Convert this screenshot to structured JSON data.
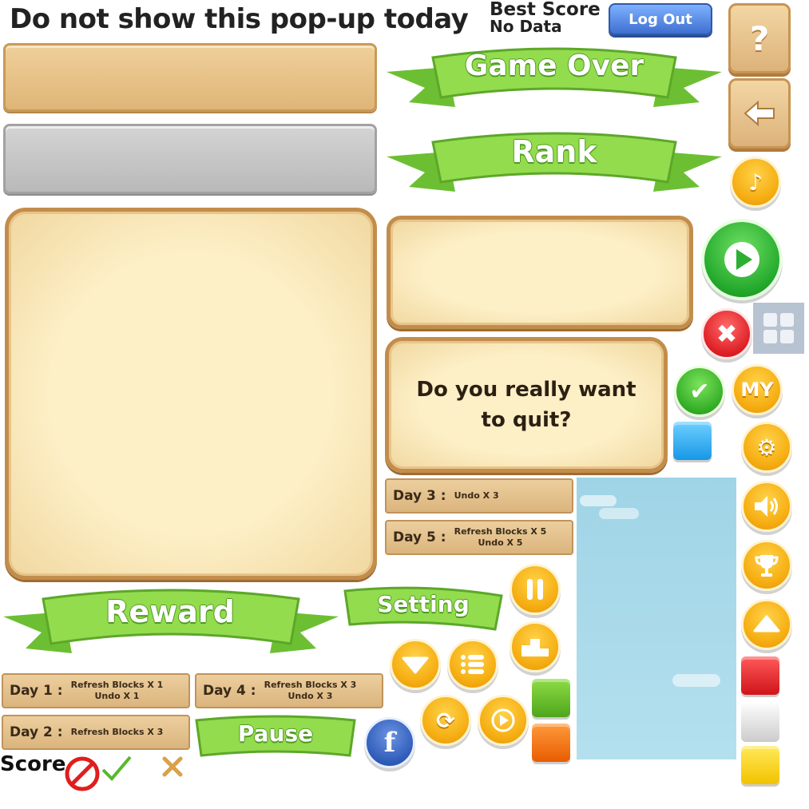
{
  "popup_notice": "Do not show this pop-up today",
  "best_score": {
    "label": "Best Score",
    "value": "No Data"
  },
  "logout_label": "Log Out",
  "banners": {
    "game_over": "Game Over",
    "rank": "Rank",
    "reward": "Reward",
    "setting": "Setting",
    "pause": "Pause"
  },
  "quit_dialog": {
    "message_line1": "Do you really want",
    "message_line2": "to quit?"
  },
  "rewards": [
    {
      "day": "Day 3 :",
      "line1": "Undo X 3",
      "line2": ""
    },
    {
      "day": "Day 5 :",
      "line1": "Refresh Blocks X 5",
      "line2": "Undo X 5"
    },
    {
      "day": "Day 1 :",
      "line1": "Refresh Blocks X 1",
      "line2": "Undo X 1"
    },
    {
      "day": "Day 4 :",
      "line1": "Refresh Blocks X 3",
      "line2": "Undo X 3"
    },
    {
      "day": "Day 2 :",
      "line1": "Refresh Blocks X 3",
      "line2": ""
    }
  ],
  "score_label": "Score",
  "my_label": "MY",
  "icons": {
    "help": "question-icon",
    "back": "arrow-left-icon",
    "music": "music-note-icon",
    "play": "play-icon",
    "close": "close-icon",
    "grid": "grid-icon",
    "confirm": "check-icon",
    "settings": "gear-icon",
    "sound": "speaker-icon",
    "trophy": "trophy-icon",
    "up": "arrow-up-icon",
    "pause": "pause-icon",
    "rank": "podium-icon",
    "down": "arrow-down-icon",
    "list": "list-icon",
    "restart": "restart-icon",
    "facebook": "facebook-icon",
    "forbidden": "no-icon",
    "x": "x-mark-icon"
  },
  "colors": {
    "ribbon_green": "#8fd84a",
    "tan": "#e6c28a",
    "parchment": "#fbe9bd",
    "sky": "#a7dbe9",
    "blue_button": "#4a7fd8"
  }
}
